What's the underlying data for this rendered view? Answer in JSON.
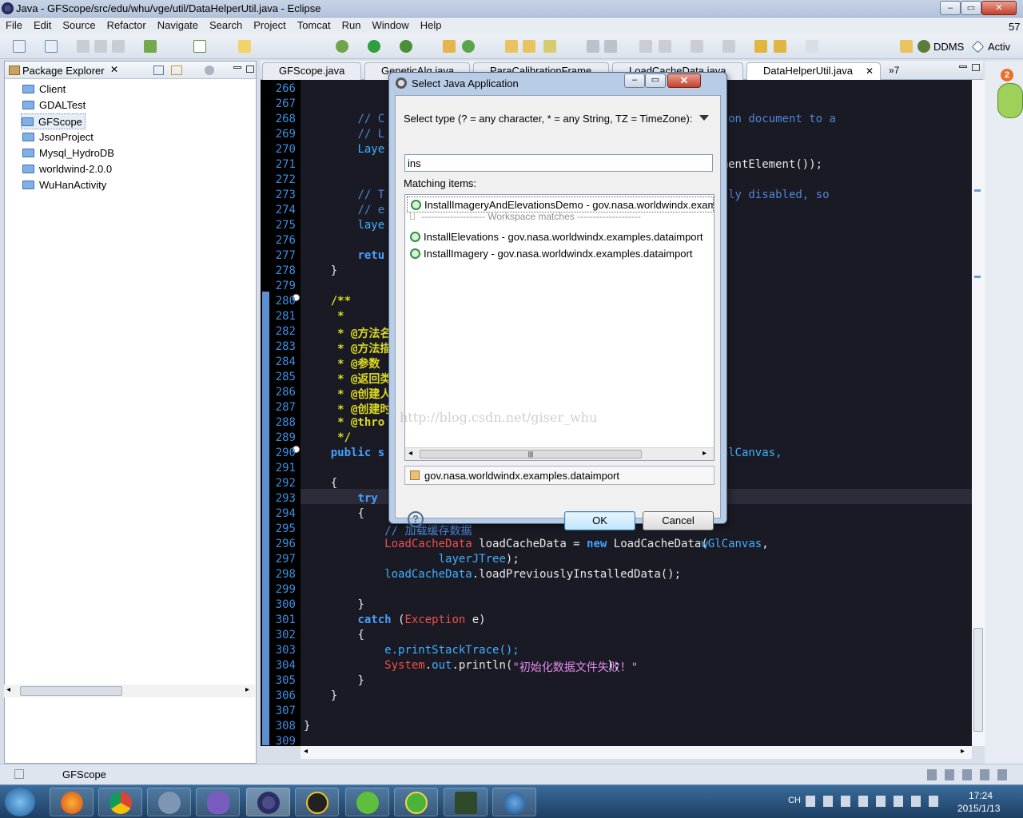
{
  "window": {
    "title": "Java - GFScope/src/edu/whu/vge/util/DataHelperUtil.java - Eclipse",
    "controls": {
      "minimize": "–",
      "maximize": "▭",
      "close": "✕"
    }
  },
  "menu": [
    "File",
    "Edit",
    "Source",
    "Refactor",
    "Navigate",
    "Search",
    "Project",
    "Tomcat",
    "Run",
    "Window",
    "Help"
  ],
  "toolbar_right": {
    "ddms": "DDMS",
    "activ": "Activ"
  },
  "package_explorer": {
    "title": "Package Explorer",
    "items": [
      "Client",
      "GDALTest",
      "GFScope",
      "JsonProject",
      "Mysql_HydroDB",
      "worldwind-2.0.0",
      "WuHanActivity"
    ]
  },
  "editor_tabs": [
    "GFScope.java",
    "GeneticAlg.java",
    "ParaCalibrationFrame",
    "LoadCacheData.java",
    "DataHelperUtil.java",
    "»7"
  ],
  "code": {
    "line_numbers": [
      "266",
      "267",
      "268",
      "269",
      "270",
      "271",
      "272",
      "273",
      "274",
      "275",
      "276",
      "277",
      "278",
      "279",
      "280",
      "281",
      "282",
      "283",
      "284",
      "285",
      "286",
      "287",
      "288",
      "289",
      "290",
      "291",
      "292",
      "293",
      "294",
      "295",
      "296",
      "297",
      "298",
      "299",
      "300",
      "301",
      "302",
      "303",
      "304",
      "305",
      "306",
      "307",
      "308",
      "309"
    ],
    "l268a": "// C",
    "l268b": "ion document to a",
    "l269": "// L",
    "l270a": "Laye",
    "l270b": "(",
    "l271": "mentElement());",
    "l273a": "// T",
    "l273b": "lly disabled, so",
    "l274": "// e",
    "l275": "laye",
    "l277": "retu",
    "l278": "}",
    "l280": "/**",
    "l281": " *",
    "l282": " * @方法名",
    "l283": " * @方法描",
    "l284": " * @参数",
    "l285": " * @返回类",
    "l286": " * @创建人",
    "l287": " * @创建时",
    "l288": " * @thro",
    "l289": " */",
    "l290a": "public s",
    "l290b": "GlCanvas,",
    "l292": "{",
    "l293": "try",
    "l294": "{",
    "l295": "// 加载缓存数据",
    "l296a": "LoadCacheData",
    "l296b": " loadCacheData = ",
    "l296c": "new",
    "l296d": " LoadCacheData(",
    "l296e": "wGlCanvas",
    "l296f": ",",
    "l297a": "layerJTree",
    "l297b": ");",
    "l298a": "loadCacheData",
    "l298b": ".loadPreviouslyInstalledData();",
    "l300": "}",
    "l301a": "catch",
    "l301b": " (",
    "l301c": "Exception",
    "l301d": " e)",
    "l302": "{",
    "l303": "e.printStackTrace();",
    "l304a": "System",
    "l304b": ".",
    "l304c": "out",
    "l304d": ".println(",
    "l304e": "\"初始化数据文件失败！\"",
    "l304f": ");",
    "l305": "}",
    "l306": "}",
    "l308": "}"
  },
  "dialog": {
    "title": "Select Java Application",
    "select_label": "Select type (? = any character, * = any String, TZ = TimeZone):",
    "input_value": "ins",
    "matching_label": "Matching items:",
    "items": [
      "InstallImageryAndElevationsDemo - gov.nasa.worldwindx.exam",
      "-------------------- Workspace matches --------------------",
      "InstallElevations - gov.nasa.worldwindx.examples.dataimport",
      "InstallImagery - gov.nasa.worldwindx.examples.dataimport"
    ],
    "package": "gov.nasa.worldwindx.examples.dataimport",
    "ok": "OK",
    "cancel": "Cancel",
    "help": "?"
  },
  "watermark": "http://blog.csdn.net/giser_whu",
  "status": {
    "selection": "GFScope"
  },
  "notification_badge": "2",
  "corner_badge": "57",
  "clock": {
    "time": "17:24",
    "date": "2015/1/13",
    "lang": "CH"
  },
  "colors": {
    "editor_bg": "#1a1a24",
    "keyword": "#45a0ff",
    "doc": "#dedc20",
    "type": "#f0504c",
    "comment": "#4f86d6"
  }
}
